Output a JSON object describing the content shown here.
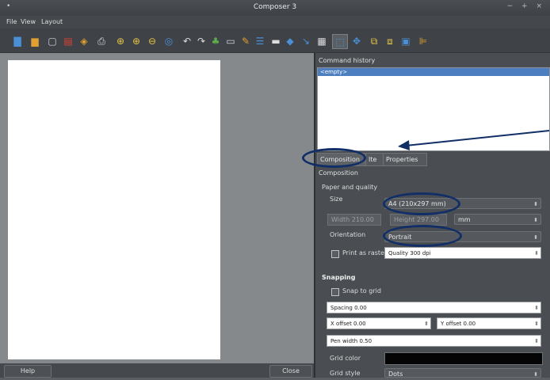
{
  "window": {
    "title": "Composer 3",
    "menu_dot": "•",
    "controls": "− + ×"
  },
  "menu": {
    "file": "File",
    "view": "View",
    "layout": "Layout"
  },
  "toolbar": {
    "icons": [
      "save-icon",
      "save-template-icon",
      "add-items-icon",
      "export-pdf-icon",
      "export-svg-icon",
      "print-icon",
      "zoom-full-icon",
      "zoom-in-icon",
      "zoom-out-icon",
      "refresh-icon",
      "undo-icon",
      "redo-icon",
      "add-map-icon",
      "add-image-icon",
      "add-label-icon",
      "add-legend-icon",
      "add-scalebar-icon",
      "add-shape-icon",
      "add-arrow-icon",
      "add-table-icon",
      "select-icon",
      "move-content-icon",
      "group-icon",
      "ungroup-icon",
      "raise-icon",
      "align-icon"
    ]
  },
  "history": {
    "title": "Command history",
    "entry": "<empty>"
  },
  "tabs": {
    "composition": "Composition",
    "item": "Ite",
    "properties": "Properties"
  },
  "composition": {
    "title": "Composition",
    "paper_header": "Paper and quality",
    "size_label": "Size",
    "size_value": "A4 (210x297 mm)",
    "width": "Width 210.00",
    "height": "Height 297.00",
    "unit": "mm",
    "orientation_label": "Orientation",
    "orientation_value": "Portrait",
    "print_raster": "Print as raster",
    "quality": "Quality 300 dpi"
  },
  "snapping": {
    "header": "Snapping",
    "snap_to_grid": "Snap to grid",
    "spacing": "Spacing 0.00",
    "x_offset": "X offset 0.00",
    "y_offset": "Y offset 0.00",
    "pen_width": "Pen width 0.50",
    "grid_color_label": "Grid color",
    "grid_color": "#050505",
    "grid_style_label": "Grid style",
    "grid_style_value": "Dots"
  },
  "buttons": {
    "help": "Help",
    "close": "Close"
  }
}
